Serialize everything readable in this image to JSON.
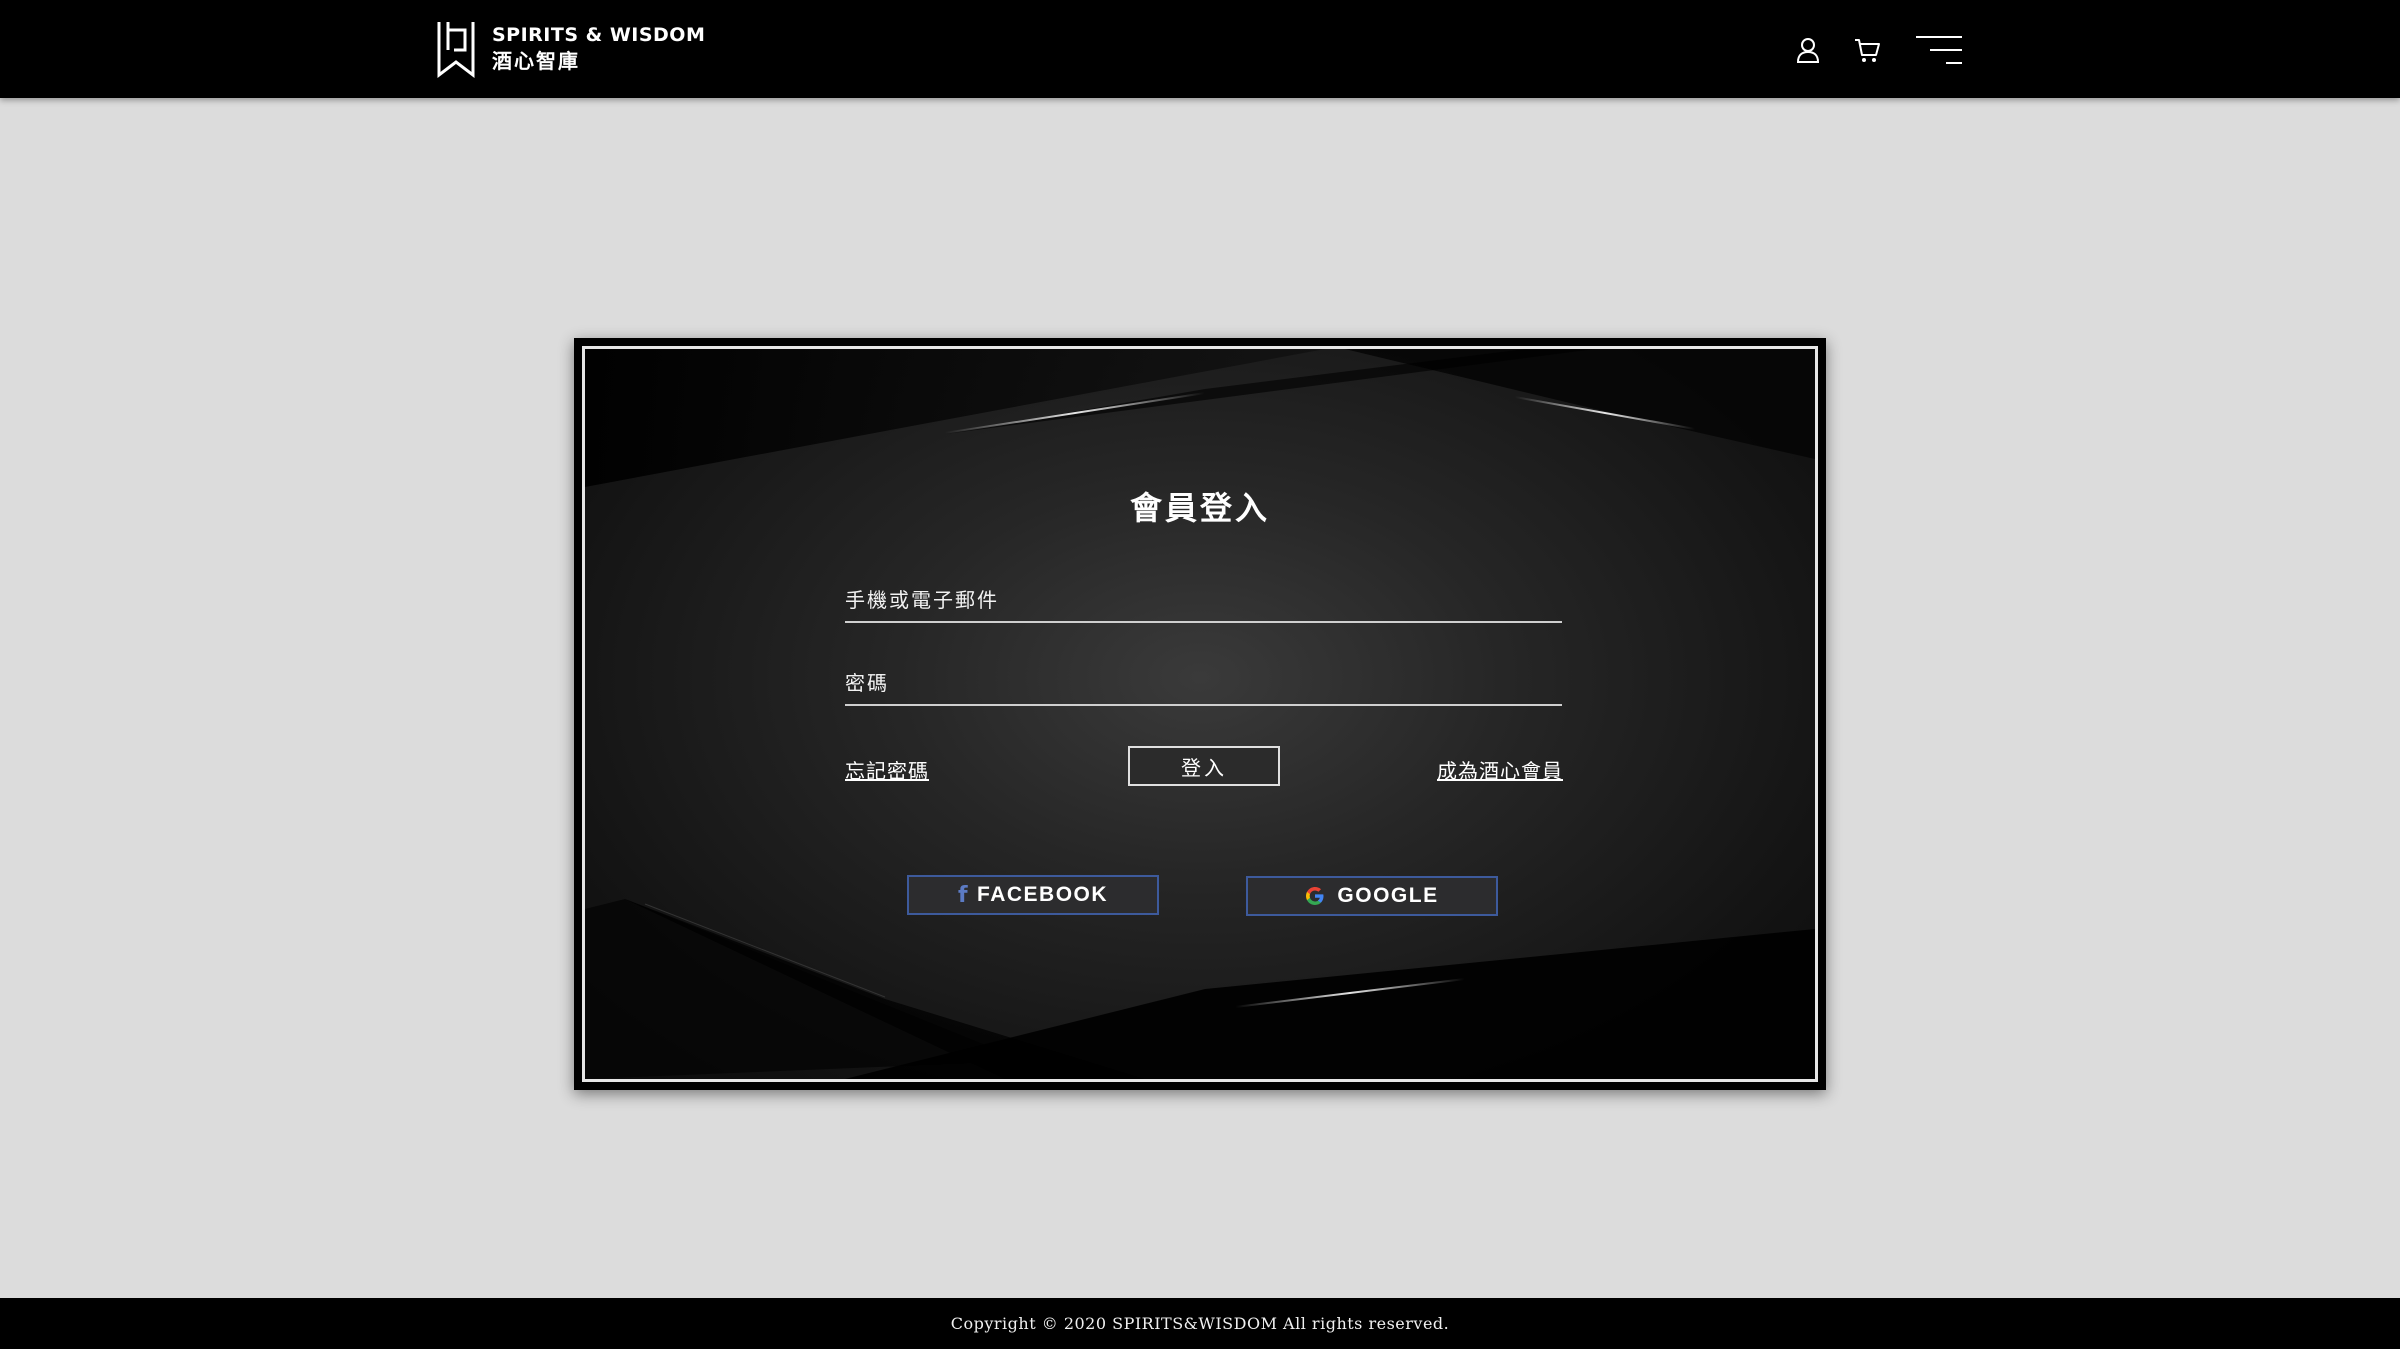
{
  "header": {
    "logo": {
      "en": "SPIRITS & WISDOM",
      "zh": "酒心智庫",
      "mark_icon": "spirits-wisdom-logo-mark"
    },
    "icons": [
      "user-icon",
      "cart-icon",
      "menu-icon"
    ]
  },
  "login": {
    "title": "會員登入",
    "account_placeholder": "手機或電子郵件",
    "password_placeholder": "密碼",
    "forgot_label": "忘記密碼",
    "login_label": "登入",
    "register_label": "成為酒心會員",
    "facebook_label": "FACEBOOK",
    "google_label": "GOOGLE"
  },
  "footer": {
    "copyright": "Copyright © 2020 SPIRITS&WISDOM All rights reserved."
  },
  "colors": {
    "page_bg": "#dcdcdc",
    "header_bg": "#000000",
    "panel_bg": "#1a1a1a",
    "social_border": "#3d5a9c",
    "facebook_blue": "#5c7bc4"
  }
}
